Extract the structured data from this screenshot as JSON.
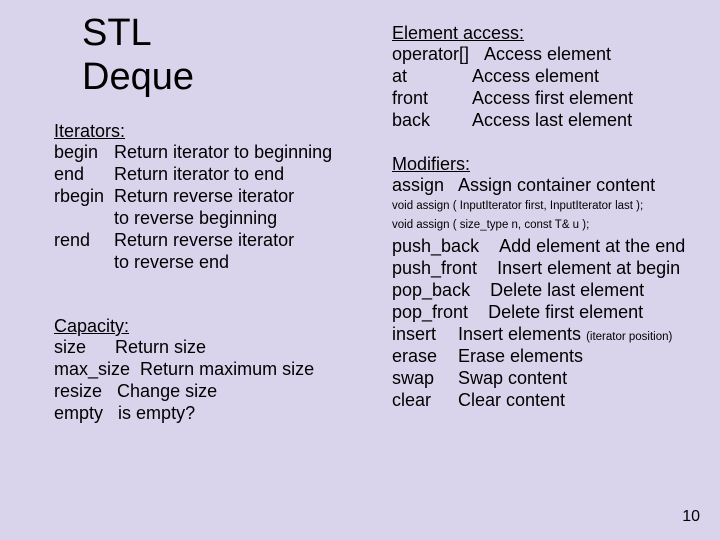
{
  "title_line1": "STL",
  "title_line2": "Deque",
  "page_number": "10",
  "left": {
    "iterators_head": "Iterators:",
    "iterators": [
      {
        "k": "begin",
        "v": "Return iterator to beginning"
      },
      {
        "k": "end",
        "v": "Return iterator to end"
      },
      {
        "k": "rbegin",
        "v": "Return reverse iterator"
      },
      {
        "k": "",
        "v": "to reverse beginning"
      },
      {
        "k": "rend",
        "v": "Return reverse iterator"
      },
      {
        "k": "",
        "v": "to reverse end"
      }
    ],
    "capacity_head": "Capacity:",
    "capacity": [
      {
        "k": "size",
        "v": "Return size"
      },
      {
        "k": "max_size",
        "v": "Return maximum size"
      },
      {
        "k": "resize",
        "v": "Change size"
      },
      {
        "k": "empty",
        "v": "is empty?"
      }
    ]
  },
  "right": {
    "access_head": "Element access:",
    "access": [
      {
        "k": "operator[]",
        "v": "Access element"
      },
      {
        "k": "at",
        "v": "Access element"
      },
      {
        "k": "front",
        "v": "Access first element"
      },
      {
        "k": "back",
        "v": "Access last element"
      }
    ],
    "modifiers_head": "Modifiers:",
    "assign_k": "assign",
    "assign_v": "Assign container content",
    "assign_sig1": "void assign ( InputIterator first, InputIterator last );",
    "assign_sig2": "void assign ( size_type n, const T& u );",
    "modifiers": [
      {
        "k": "push_back",
        "v": "Add element at the end"
      },
      {
        "k": "push_front",
        "v": "Insert element at begin"
      },
      {
        "k": "pop_back",
        "v": "Delete last element"
      },
      {
        "k": "pop_front",
        "v": "Delete first element"
      },
      {
        "k": "insert",
        "v": "Insert elements",
        "note": "(iterator position)"
      },
      {
        "k": "erase",
        "v": "Erase elements"
      },
      {
        "k": "swap",
        "v": "Swap content"
      },
      {
        "k": "clear",
        "v": "Clear content"
      }
    ]
  }
}
